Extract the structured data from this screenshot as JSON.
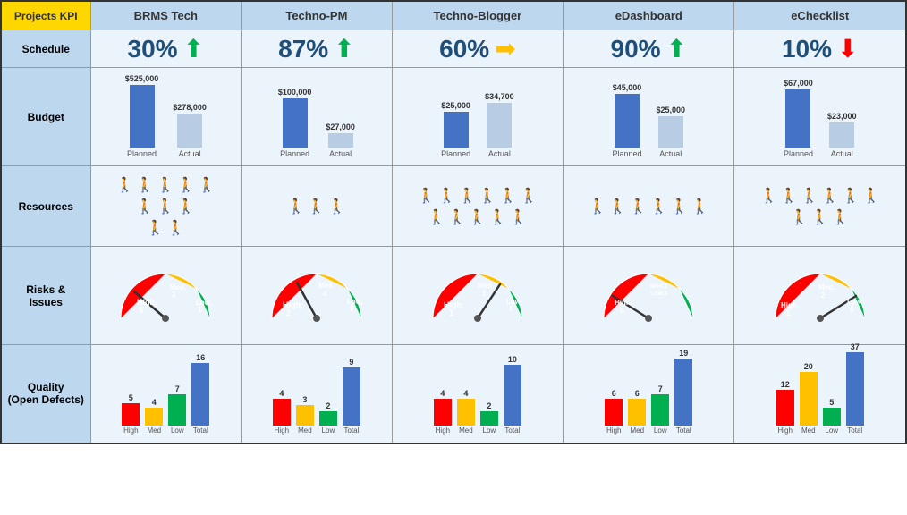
{
  "header": {
    "kpi_label": "Projects KPI",
    "projects": [
      "BRMS Tech",
      "Techno-PM",
      "Techno-Blogger",
      "eDashboard",
      "eChecklist"
    ]
  },
  "rows": {
    "schedule": "Schedule",
    "budget": "Budget",
    "resources": "Resources",
    "risks": "Risks &\nIssues",
    "quality": "Quality\n(Open Defects)"
  },
  "schedule": [
    {
      "value": "30%",
      "arrow": "up",
      "color": "green"
    },
    {
      "value": "87%",
      "arrow": "up",
      "color": "green"
    },
    {
      "value": "60%",
      "arrow": "right",
      "color": "yellow"
    },
    {
      "value": "90%",
      "arrow": "up",
      "color": "green"
    },
    {
      "value": "10%",
      "arrow": "down",
      "color": "red"
    }
  ],
  "budget": [
    {
      "planned": "$525,000",
      "actual": "$278,000",
      "planned_h": 70,
      "actual_h": 38
    },
    {
      "planned": "$100,000",
      "actual": "$27,000",
      "planned_h": 55,
      "actual_h": 16
    },
    {
      "planned": "$25,000",
      "actual": "$34,700",
      "planned_h": 40,
      "actual_h": 50
    },
    {
      "planned": "$45,000",
      "actual": "$25,000",
      "planned_h": 60,
      "actual_h": 35
    },
    {
      "planned": "$67,000",
      "actual": "$23,000",
      "planned_h": 65,
      "actual_h": 28
    }
  ],
  "resources": [
    {
      "green": 8,
      "red": 2
    },
    {
      "green": 3,
      "red": 0
    },
    {
      "green": 6,
      "red": 4
    },
    {
      "green": 6,
      "red": 0
    },
    {
      "green": 6,
      "red": 0,
      "green2": 3
    }
  ],
  "risks": [
    {
      "high": 5,
      "med": 2,
      "low": 1,
      "needle": 30
    },
    {
      "high": 2,
      "med": 4,
      "low": 2,
      "needle": 55
    },
    {
      "high": 1,
      "med": 1,
      "low": 1,
      "needle": 75
    },
    {
      "high": 5,
      "med": 1,
      "low": 1,
      "needle": 20
    },
    {
      "high": 1,
      "med": 2,
      "low": 5,
      "needle": 80
    }
  ],
  "quality": [
    {
      "high": 5,
      "med": 4,
      "low": 7,
      "total": 16
    },
    {
      "high": 4,
      "med": 3,
      "low": 2,
      "total": 9
    },
    {
      "high": 4,
      "med": 4,
      "low": 2,
      "total": 10
    },
    {
      "high": 6,
      "med": 6,
      "low": 7,
      "total": 19
    },
    {
      "high": 12,
      "med": 20,
      "low": 5,
      "total": 37
    }
  ],
  "quality_labels": [
    "High",
    "Med",
    "Low",
    "Total"
  ]
}
